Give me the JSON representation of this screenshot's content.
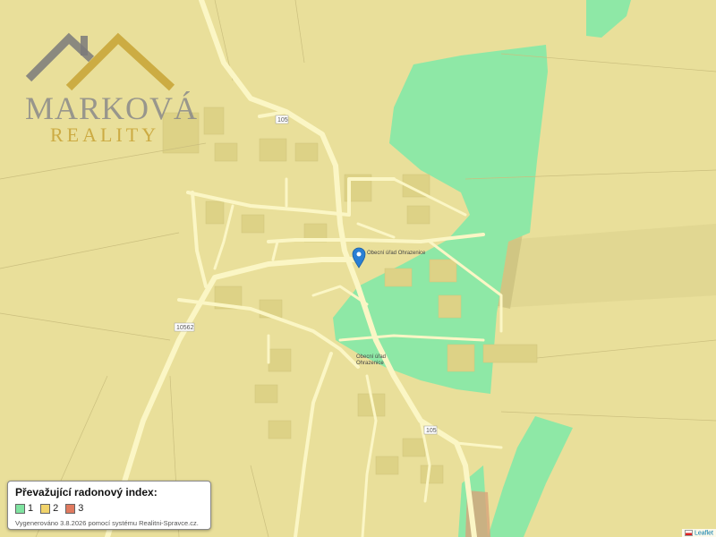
{
  "logo": {
    "line1": "MARKOVÁ",
    "line2": "REALITY",
    "colors": {
      "roof_left": "#7a7a7a",
      "roof_right": "#c9a63a"
    }
  },
  "road_labels": [
    "105",
    "10562",
    "105"
  ],
  "poi_labels": [
    "Obecní úřad Ohrazenice",
    "Obecní úřad",
    "Ohrazenice"
  ],
  "marker": {
    "icon": "map-pin-icon",
    "color": "#2a7fd4"
  },
  "legend": {
    "title": "Převažující radonový index:",
    "items": [
      {
        "label": "1",
        "color": "#7fe3a0"
      },
      {
        "label": "2",
        "color": "#f1d36b"
      },
      {
        "label": "3",
        "color": "#e07a5f"
      }
    ],
    "footer": "Vygenerováno 3.8.2026 pomocí systému Realitni-Spravce.cz."
  },
  "attribution": "Leaflet",
  "colors": {
    "zone1": "#8ee8a6",
    "zone2": "#e9df9a",
    "zone3": "#d8a27a",
    "road": "#fbf6c5"
  }
}
